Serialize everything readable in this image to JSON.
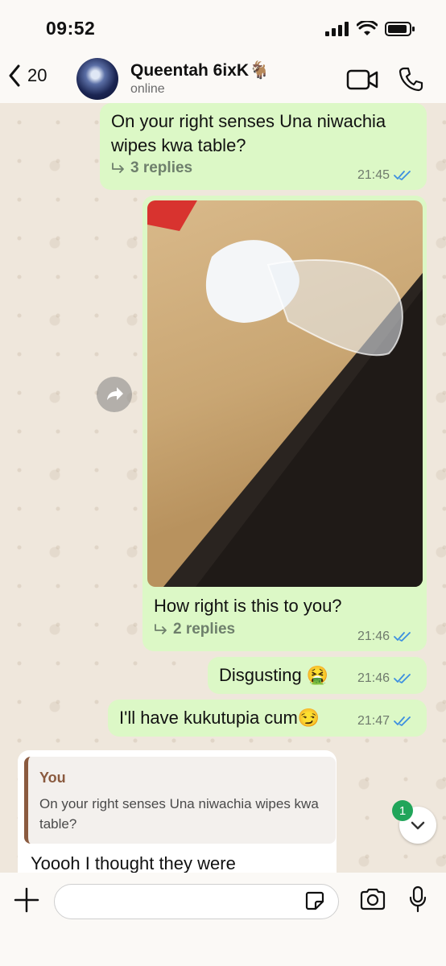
{
  "status_bar": {
    "time": "09:52"
  },
  "header": {
    "back_count": "20",
    "contact_name": "Queentah 6ixK🐐",
    "contact_status": "online"
  },
  "messages": [
    {
      "text_line1": "On your right senses Una niwachia",
      "text_line2": "wipes kwa table?",
      "replies": "3 replies",
      "time": "21:45"
    },
    {
      "caption": "How right is this to you?",
      "replies": "2 replies",
      "time": "21:46"
    },
    {
      "text": "Disgusting 🤮",
      "time": "21:46"
    },
    {
      "text": "I'll have kukutupia cum😏",
      "time": "21:47"
    }
  ],
  "incoming": {
    "quote_author": "You",
    "quote_text": "On your right senses Una niwachia wipes kwa table?",
    "text": "Yoooh I thought they were"
  },
  "unread_badge": "1",
  "colors": {
    "outgoing_bubble": "#dcf8c6",
    "read_ticks": "#3d8fe0",
    "quote_accent": "#8a5a3f",
    "badge": "#21a55a"
  }
}
